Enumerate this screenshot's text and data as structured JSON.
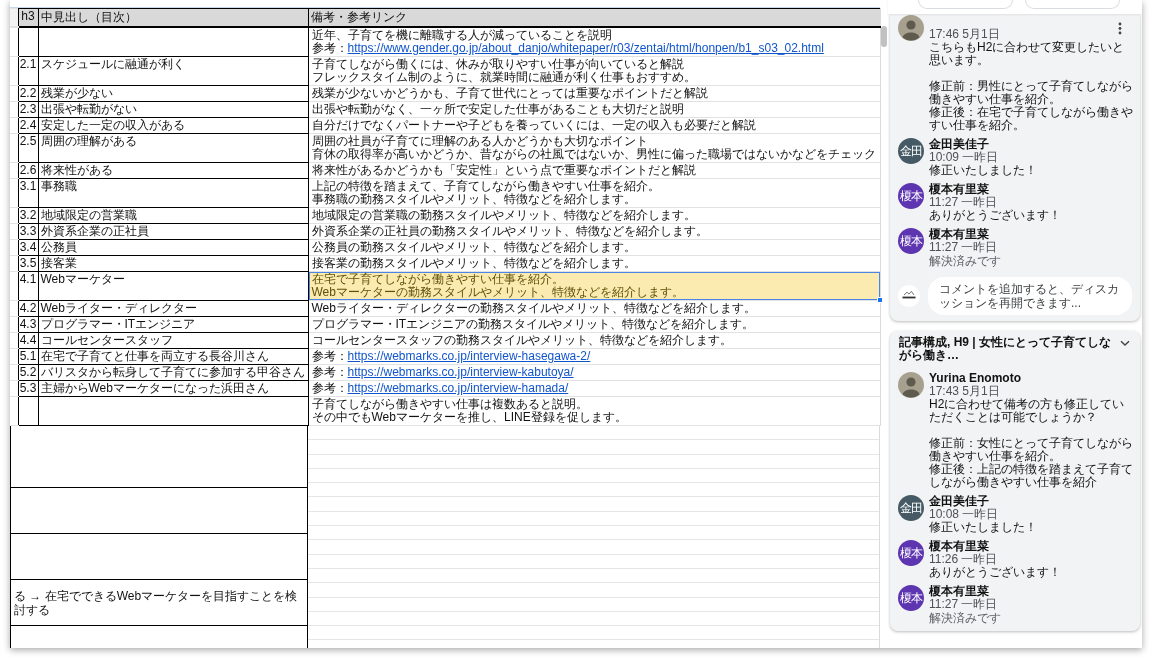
{
  "sheet": {
    "columns": [
      "h3",
      "中見出し（目次）",
      "備考・参考リンク"
    ],
    "rows": [
      {
        "notes": [
          {
            "text": "近年、子育てを機に離職する人が減っていることを説明"
          },
          {
            "text": "参考：",
            "link": "https://www.gender.go.jp/about_danjo/whitepaper/r03/zentai/html/honpen/b1_s03_02.html"
          }
        ],
        "selected": false,
        "commented": false
      },
      {
        "h3": "2.1",
        "heading": "スケジュールに融通が利く",
        "notes": [
          {
            "text": "子育てしながら働くには、休みが取りやすい仕事が向いていると解説"
          },
          {
            "text": "フレックスタイム制のように、就業時間に融通が利く仕事もおすすめ。"
          }
        ],
        "selected": false,
        "commented": false
      },
      {
        "h3": "2.2",
        "heading": "残業が少ない",
        "notes": [
          {
            "text": "残業が少ないかどうかも、子育て世代にとっては重要なポイントだと解説"
          }
        ],
        "selected": false,
        "commented": false
      },
      {
        "h3": "2.3",
        "heading": "出張や転勤がない",
        "notes": [
          {
            "text": "出張や転勤がなく、一ヶ所で安定した仕事があることも大切だと説明"
          }
        ],
        "selected": false,
        "commented": false
      },
      {
        "h3": "2.4",
        "heading": "安定した一定の収入がある",
        "notes": [
          {
            "text": "自分だけでなくパートナーや子どもを養っていくには、一定の収入も必要だと解説"
          }
        ],
        "selected": false,
        "commented": false
      },
      {
        "h3": "2.5",
        "heading": "周囲の理解がある",
        "notes": [
          {
            "text": "周囲の社員が子育てに理解のある人かどうかも大切なポイント"
          },
          {
            "text": "育休の取得率が高いかどうか、昔ながらの社風ではないか、男性に偏った職場ではないかなどをチェック"
          }
        ],
        "selected": false,
        "commented": false
      },
      {
        "h3": "2.6",
        "heading": "将来性がある",
        "notes": [
          {
            "text": "将来性があるかどうかも「安定性」という点で重要なポイントだと解説"
          }
        ],
        "selected": false,
        "commented": false
      },
      {
        "h3": "3.1",
        "heading": "事務職",
        "notes": [
          {
            "text": "上記の特徴を踏まえて、子育てしながら働きやすい仕事を紹介。"
          },
          {
            "text": "事務職の勤務スタイルやメリット、特徴などを紹介します。"
          }
        ],
        "selected": false,
        "commented": false
      },
      {
        "h3": "3.2",
        "heading": "地域限定の営業職",
        "notes": [
          {
            "text": "地域限定の営業職の勤務スタイルやメリット、特徴などを紹介します。"
          }
        ],
        "selected": false,
        "commented": false
      },
      {
        "h3": "3.3",
        "heading": "外資系企業の正社員",
        "notes": [
          {
            "text": "外資系企業の正社員の勤務スタイルやメリット、特徴などを紹介します。"
          }
        ],
        "selected": false,
        "commented": false
      },
      {
        "h3": "3.4",
        "heading": "公務員",
        "notes": [
          {
            "text": "公務員の勤務スタイルやメリット、特徴などを紹介します。"
          }
        ],
        "selected": false,
        "commented": false
      },
      {
        "h3": "3.5",
        "heading": "接客業",
        "notes": [
          {
            "text": "接客業の勤務スタイルやメリット、特徴などを紹介します。"
          }
        ],
        "selected": false,
        "commented": false
      },
      {
        "h3": "4.1",
        "heading": "Webマーケター",
        "notes": [
          {
            "text": "在宅で子育てしながら働きやすい仕事を紹介。"
          },
          {
            "text": "Webマーケターの勤務スタイルやメリット、特徴などを紹介します。"
          }
        ],
        "selected": true,
        "commented": true
      },
      {
        "h3": "4.2",
        "heading": "Webライター・ディレクター",
        "notes": [
          {
            "text": "Webライター・ディレクターの勤務スタイルやメリット、特徴などを紹介します。"
          }
        ],
        "selected": false,
        "commented": false
      },
      {
        "h3": "4.3",
        "heading": "プログラマー・ITエンジニア",
        "notes": [
          {
            "text": "プログラマー・ITエンジニアの勤務スタイルやメリット、特徴などを紹介します。"
          }
        ],
        "selected": false,
        "commented": false
      },
      {
        "h3": "4.4",
        "heading": "コールセンタースタッフ",
        "notes": [
          {
            "text": "コールセンタースタッフの勤務スタイルやメリット、特徴などを紹介します。"
          }
        ],
        "selected": false,
        "commented": false
      },
      {
        "h3": "5.1",
        "heading": "在宅で子育てと仕事を両立する長谷川さん",
        "notes": [
          {
            "text": "参考：",
            "link": "https://webmarks.co.jp/interview-hasegawa-2/"
          }
        ],
        "selected": false,
        "commented": false
      },
      {
        "h3": "5.2",
        "heading": "バリスタから転身して子育てに参加する甲谷さん",
        "notes": [
          {
            "text": "参考：",
            "link": "https://webmarks.co.jp/interview-kabutoya/"
          }
        ],
        "selected": false,
        "commented": false
      },
      {
        "h3": "5.3",
        "heading": "主婦からWebマーケターになった浜田さん",
        "notes": [
          {
            "text": "参考：",
            "link": "https://webmarks.co.jp/interview-hamada/"
          }
        ],
        "selected": false,
        "commented": false
      },
      {
        "notes": [
          {
            "text": "子育てしながら働きやすい仕事は複数あると説明。"
          },
          {
            "text": "その中でもWebマーケターを推し、LINE登録を促します。"
          }
        ],
        "selected": false,
        "commented": false
      }
    ],
    "lower_note": "る → 在宅でできるWebマーケターを目指すことを検討する"
  },
  "comments_panel": {
    "threads": [
      {
        "comments": [
          {
            "avatar": {
              "kind": "photo"
            },
            "time": "17:46 5月1日",
            "kind": "message",
            "paragraphs": [
              [
                "こちらもH2に合わせて変更したいと思います。"
              ],
              [
                "修正前：男性にとって子育てしながら働きやすい仕事を紹介。",
                "修正後：在宅で子育てしながら働きやすい仕事を紹介。"
              ]
            ],
            "menu_shown": true
          },
          {
            "avatar": {
              "kind": "initials",
              "text": "金田",
              "color": "#455a64"
            },
            "author": "金田美佳子",
            "time": "10:09 一昨日",
            "kind": "message",
            "paragraphs": [
              [
                "修正いたしました！"
              ]
            ],
            "menu_shown": false
          },
          {
            "avatar": {
              "kind": "initials",
              "text": "榎本",
              "color": "#5e35b1"
            },
            "author": "榎本有里菜",
            "time": "11:27 一昨日",
            "kind": "message",
            "paragraphs": [
              [
                "ありがとうございます！"
              ]
            ],
            "menu_shown": false
          },
          {
            "avatar": {
              "kind": "initials",
              "text": "榎本",
              "color": "#5e35b1"
            },
            "author": "榎本有里菜",
            "time": "11:27 一昨日",
            "kind": "resolved",
            "text": "解決済みです",
            "menu_shown": false
          }
        ],
        "reply": {
          "placeholder": "コメントを追加すると、ディスカッションを再開できます..."
        }
      },
      {
        "title": "記事構成, H9 | 女性にとって子育てしながら働き…",
        "comments": [
          {
            "avatar": {
              "kind": "photo"
            },
            "author": "Yurina Enomoto",
            "time": "17:43 5月1日",
            "kind": "message",
            "paragraphs": [
              [
                "H2に合わせて備考の方も修正していただくことは可能でしょうか？"
              ],
              [
                "修正前：女性にとって子育てしながら働きやすい仕事を紹介。",
                "修正後：上記の特徴を踏まえて子育てしながら働きやすい仕事を紹介"
              ]
            ],
            "menu_shown": false
          },
          {
            "avatar": {
              "kind": "initials",
              "text": "金田",
              "color": "#455a64"
            },
            "author": "金田美佳子",
            "time": "10:08 一昨日",
            "kind": "message",
            "paragraphs": [
              [
                "修正いたしました！"
              ]
            ],
            "menu_shown": false
          },
          {
            "avatar": {
              "kind": "initials",
              "text": "榎本",
              "color": "#5e35b1"
            },
            "author": "榎本有里菜",
            "time": "11:26 一昨日",
            "kind": "message",
            "paragraphs": [
              [
                "ありがとうございます！"
              ]
            ],
            "menu_shown": false
          },
          {
            "avatar": {
              "kind": "initials",
              "text": "榎本",
              "color": "#5e35b1"
            },
            "author": "榎本有里菜",
            "time": "11:27 一昨日",
            "kind": "resolved",
            "text": "解決済みです",
            "menu_shown": false
          }
        ]
      }
    ]
  }
}
